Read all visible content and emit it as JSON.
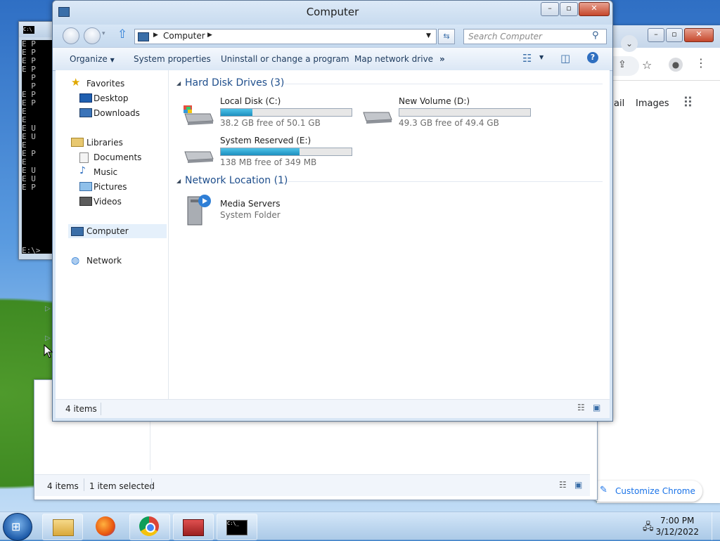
{
  "cmd": {
    "lines": "E P\nE P\nE P\nE P\n  P\n  P\nE P\nE P\nE\nE\nE U\nE U\nE\nE P\nE\nE U\nE U\nE P",
    "prompt": "E:\\>"
  },
  "chrome": {
    "images_label": "Images",
    "gmail_partial": "ail",
    "customize_label": "Customize Chrome"
  },
  "explorer2": {
    "status_count": "4 items",
    "status_selected": "1 item selected"
  },
  "explorer": {
    "title": "Computer",
    "address_crumb": "Computer",
    "search_placeholder": "Search Computer",
    "toolbar": {
      "organize": "Organize",
      "system_properties": "System properties",
      "uninstall": "Uninstall or change a program",
      "map_drive": "Map network drive",
      "more": "»"
    },
    "navpane": {
      "favorites": "Favorites",
      "desktop": "Desktop",
      "downloads": "Downloads",
      "libraries": "Libraries",
      "documents": "Documents",
      "music": "Music",
      "pictures": "Pictures",
      "videos": "Videos",
      "computer": "Computer",
      "network": "Network"
    },
    "groups": {
      "hard_disks": "Hard Disk Drives (3)",
      "network_location": "Network Location (1)"
    },
    "drives": [
      {
        "name": "Local Disk (C:)",
        "free": "38.2 GB free of 50.1 GB",
        "used_fraction": 0.24
      },
      {
        "name": "New Volume (D:)",
        "free": "49.3 GB free of 49.4 GB",
        "used_fraction": 0.0
      },
      {
        "name": "System Reserved (E:)",
        "free": "138 MB free of 349 MB",
        "used_fraction": 0.6
      }
    ],
    "network_item": {
      "name": "Media Servers",
      "type": "System Folder"
    },
    "status_count": "4 items"
  },
  "taskbar": {
    "time": "7:00 PM",
    "date": "3/12/2022"
  },
  "colors": {
    "accent": "#1e4e8c",
    "bar_fill": "#26a0d0"
  }
}
